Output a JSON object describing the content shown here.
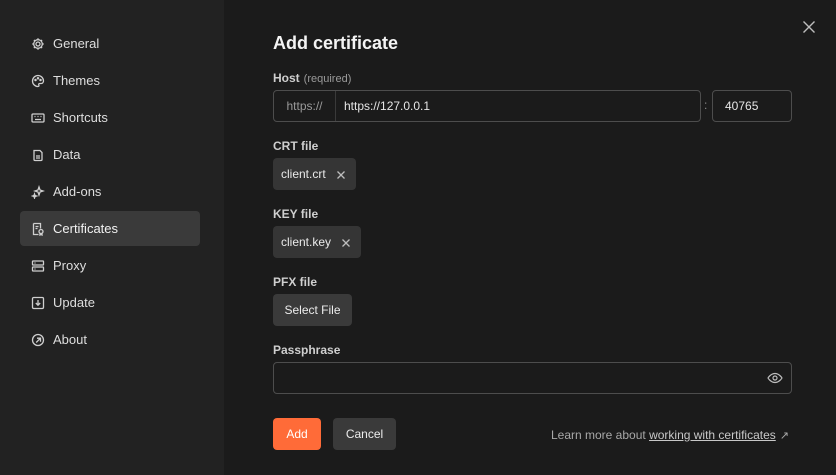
{
  "sidebar": {
    "items": [
      {
        "label": "General",
        "icon": "gear-icon",
        "active": false
      },
      {
        "label": "Themes",
        "icon": "palette-icon",
        "active": false
      },
      {
        "label": "Shortcuts",
        "icon": "keyboard-icon",
        "active": false
      },
      {
        "label": "Data",
        "icon": "database-icon",
        "active": false
      },
      {
        "label": "Add-ons",
        "icon": "sparkles-icon",
        "active": false
      },
      {
        "label": "Certificates",
        "icon": "certificate-icon",
        "active": true
      },
      {
        "label": "Proxy",
        "icon": "server-icon",
        "active": false
      },
      {
        "label": "Update",
        "icon": "download-icon",
        "active": false
      },
      {
        "label": "About",
        "icon": "info-icon",
        "active": false
      }
    ]
  },
  "dialog": {
    "title": "Add certificate",
    "host": {
      "label": "Host",
      "hint": "(required)",
      "prefix": "https://",
      "value": "https://127.0.0.1",
      "separator": ":",
      "port": "40765"
    },
    "crt": {
      "label": "CRT file",
      "file": "client.crt"
    },
    "key": {
      "label": "KEY file",
      "file": "client.key"
    },
    "pfx": {
      "label": "PFX file",
      "button": "Select File"
    },
    "passphrase": {
      "label": "Passphrase",
      "value": ""
    },
    "actions": {
      "add": "Add",
      "cancel": "Cancel"
    },
    "learn_more": {
      "prefix": "Learn more about",
      "link": "working with certificates",
      "arrow": "↗"
    }
  },
  "colors": {
    "accent": "#ff6b38",
    "background": "#1b1b1b",
    "sidebar": "#222222"
  }
}
